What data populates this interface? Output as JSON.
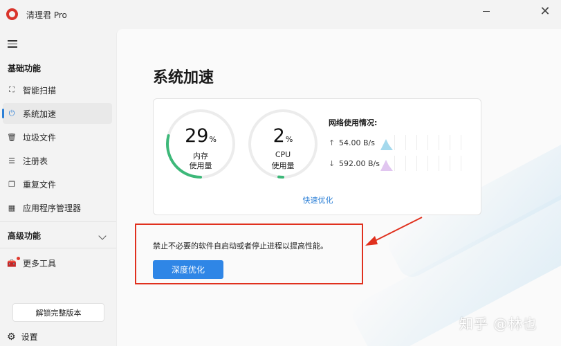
{
  "app": {
    "title": "清理君 Pro"
  },
  "window_controls": {
    "minimize": "minimize-icon",
    "close": "close-icon",
    "close_glyph": "✕"
  },
  "sidebar": {
    "menu_icon": "hamburger-icon",
    "basic_section": "基础功能",
    "basic_items": [
      {
        "label": "智能扫描",
        "icon": "scan-icon",
        "glyph": "⛶"
      },
      {
        "label": "系统加速",
        "icon": "power-icon",
        "glyph": "⏻",
        "active": true
      },
      {
        "label": "垃圾文件",
        "icon": "trash-icon",
        "glyph": "🗑"
      },
      {
        "label": "注册表",
        "icon": "registry-icon",
        "glyph": "☰"
      },
      {
        "label": "重复文件",
        "icon": "copy-icon",
        "glyph": "❐"
      },
      {
        "label": "应用程序管理器",
        "icon": "grid-icon",
        "glyph": "▦"
      }
    ],
    "advanced_section": "高级功能",
    "more_tools": {
      "label": "更多工具",
      "icon": "toolbox-icon",
      "glyph": "🧰"
    },
    "unlock_label": "解锁完整版本",
    "settings_label": "设置",
    "settings_glyph": "⚙"
  },
  "main": {
    "title": "系统加速",
    "memory": {
      "value": "29",
      "unit": "%",
      "label_line1": "内存",
      "label_line2": "使用量",
      "fraction": 0.29,
      "color": "#3db879"
    },
    "cpu": {
      "value": "2",
      "unit": "%",
      "label_line1": "CPU",
      "label_line2": "使用量",
      "fraction": 0.02,
      "color": "#3db879"
    },
    "network": {
      "title": "网络使用情况:",
      "upload": {
        "arrow": "↑",
        "value": "54.00 B/s",
        "color": "#8fd0e8"
      },
      "download": {
        "arrow": "↓",
        "value": "592.00 B/s",
        "color": "#d9b8ec"
      }
    },
    "quick_optimize": "快速优化",
    "hint": "禁止不必要的软件自启动或者停止进程以提高性能。",
    "deep_optimize": "深度优化"
  },
  "annotation": {
    "color": "#e0301e"
  },
  "watermark": "知乎 @林也"
}
